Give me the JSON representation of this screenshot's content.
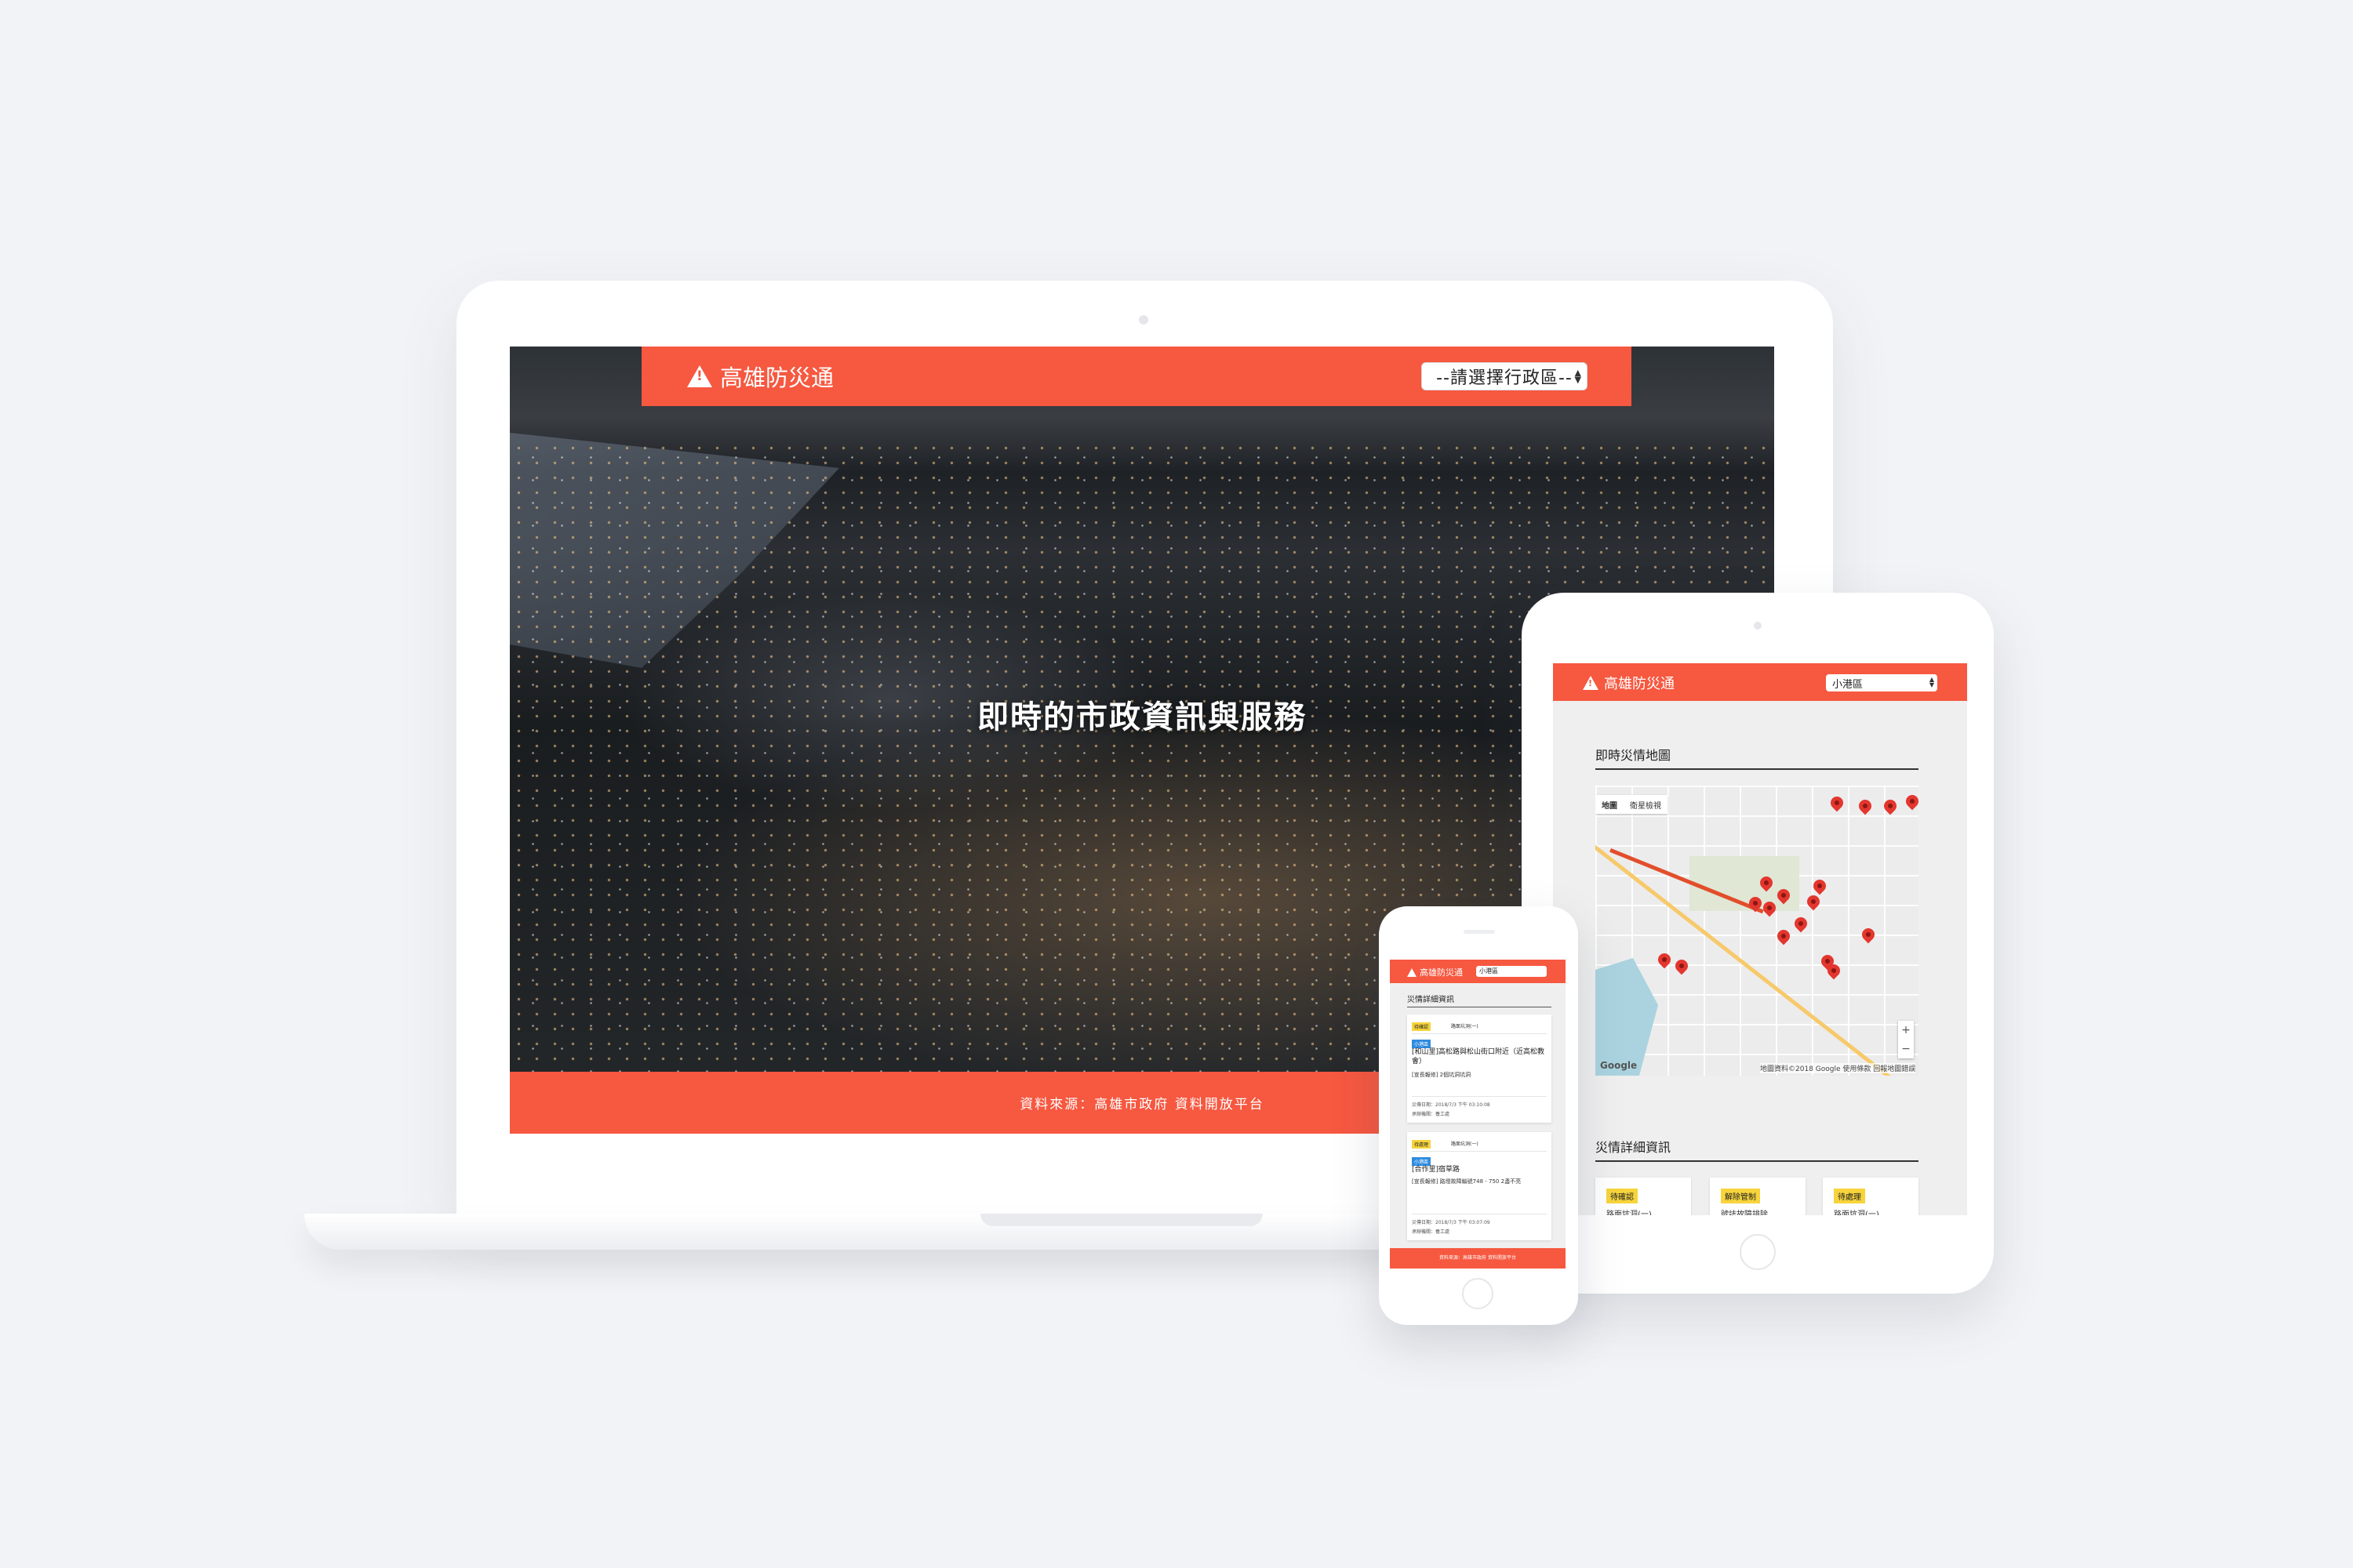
{
  "app": {
    "name": "高雄防災通"
  },
  "laptop": {
    "select_placeholder": "--請選擇行政區--",
    "hero_text": "即時的市政資訊與服務",
    "footer_text": "資料來源：高雄市政府 資料開放平台"
  },
  "tablet": {
    "district": "小港區",
    "map_heading": "即時災情地圖",
    "map_tabs": [
      "地圖",
      "衛星檢視"
    ],
    "map_google": "Google",
    "map_attribution": "地圖資料©2018 Google 使用條款 回報地圖錯誤",
    "zoom_in": "+",
    "zoom_out": "−",
    "details_heading": "災情詳細資訊",
    "cards": [
      {
        "badge": "待確認",
        "text": "路面坑洞(一)"
      },
      {
        "badge": "解除管制",
        "text": "號誌故障排除"
      },
      {
        "badge": "待處理",
        "text": "路面坑洞(一)"
      }
    ]
  },
  "phone": {
    "district": "小港區",
    "heading": "災情詳細資訊",
    "cards": [
      {
        "status": "待確認",
        "category": "路面坑洞(一)",
        "tag": "小港區",
        "title": "[和山里]高松路與松山街口附近（近高松教會）",
        "desc": "[宣長報修] 2個坑洞坑洞",
        "time": "災傳日期：2018/7/3 下午 03:10:08",
        "unit": "承辦機關：養工處"
      },
      {
        "status": "待處理",
        "category": "路面坑洞(一)",
        "tag": "小港區",
        "title": "[合作里]宿草路",
        "desc": "[宣長報修] 路燈故障編號748 - 750 2盞不亮",
        "time": "災傳日期：2018/7/3 下午 03:07:09",
        "unit": "承辦機關：養工處"
      }
    ],
    "footer_text": "資料來源：高雄市政府 資料開放平台"
  },
  "colors": {
    "brand": "#f65840",
    "badge_yellow": "#f7d43c",
    "tag_blue": "#2e8be0",
    "map_pin": "#e3362e"
  }
}
